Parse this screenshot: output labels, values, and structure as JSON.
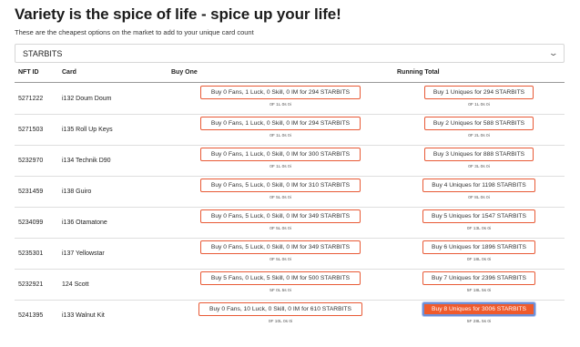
{
  "title": "Variety is the spice of life - spice up your life!",
  "subtitle": "These are the cheapest options on the market to add to your unique card count",
  "currency_select": {
    "value": "STARBITS"
  },
  "table": {
    "headers": {
      "nft_id": "NFT ID",
      "card": "Card",
      "buy_one": "Buy One",
      "running_total": "Running Total"
    },
    "rows": [
      {
        "nft_id": "5271222",
        "card": "i132 Doum Doum",
        "buy_label": "Buy 0 Fans, 1 Luck, 0 Skill, 0 IM for 294 STARBITS",
        "buy_note": "0F 1L 0s 0i",
        "total_label": "Buy 1 Uniques for 294 STARBITS",
        "total_note": "0F 1L 0s 0i"
      },
      {
        "nft_id": "5271503",
        "card": "i135 Roll Up Keys",
        "buy_label": "Buy 0 Fans, 1 Luck, 0 Skill, 0 IM for 294 STARBITS",
        "buy_note": "0F 1L 0s 0i",
        "total_label": "Buy 2 Uniques for 588 STARBITS",
        "total_note": "0F 2L 0s 0i"
      },
      {
        "nft_id": "5232970",
        "card": "i134 Technik D90",
        "buy_label": "Buy 0 Fans, 1 Luck, 0 Skill, 0 IM for 300 STARBITS",
        "buy_note": "0F 1L 0s 0i",
        "total_label": "Buy 3 Uniques for 888 STARBITS",
        "total_note": "0F 3L 0s 0i"
      },
      {
        "nft_id": "5231459",
        "card": "i138 Guiro",
        "buy_label": "Buy 0 Fans, 5 Luck, 0 Skill, 0 IM for 310 STARBITS",
        "buy_note": "0F 5L 0s 0i",
        "total_label": "Buy 4 Uniques for 1198 STARBITS",
        "total_note": "0F 8L 0s 0i"
      },
      {
        "nft_id": "5234099",
        "card": "i136 Otamatone",
        "buy_label": "Buy 0 Fans, 5 Luck, 0 Skill, 0 IM for 349 STARBITS",
        "buy_note": "0F 5L 0s 0i",
        "total_label": "Buy 5 Uniques for 1547 STARBITS",
        "total_note": "0F 13L 0s 0i"
      },
      {
        "nft_id": "5235301",
        "card": "i137 Yellowstar",
        "buy_label": "Buy 0 Fans, 5 Luck, 0 Skill, 0 IM for 349 STARBITS",
        "buy_note": "0F 5L 0s 0i",
        "total_label": "Buy 6 Uniques for 1896 STARBITS",
        "total_note": "0F 18L 0s 0i"
      },
      {
        "nft_id": "5232921",
        "card": "124 Scott",
        "buy_label": "Buy 5 Fans, 0 Luck, 5 Skill, 0 IM for 500 STARBITS",
        "buy_note": "5F 0L 5s 0i",
        "total_label": "Buy 7 Uniques for 2396 STARBITS",
        "total_note": "5F 18L 5s 0i"
      },
      {
        "nft_id": "5241395",
        "card": "i133 Walnut Kit",
        "buy_label": "Buy 0 Fans, 10 Luck, 0 Skill, 0 IM for 610 STARBITS",
        "buy_note": "0F 10L 0s 0i",
        "total_label": "Buy 8 Uniques for 3006 STARBITS",
        "total_note": "5F 28L 5s 0i"
      }
    ]
  },
  "colors": {
    "accent": "#ef5a2c",
    "focus_ring": "#6d8fd8"
  },
  "icons": {
    "select_toggle": "chevron-down-icon"
  }
}
